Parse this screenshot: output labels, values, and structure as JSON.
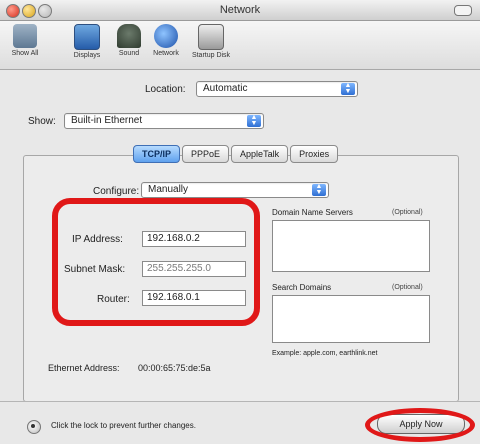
{
  "window": {
    "title": "Network"
  },
  "toolbar": {
    "items": [
      {
        "label": "Show All",
        "icon": "show-all-icon"
      },
      {
        "label": "Displays",
        "icon": "displays-icon"
      },
      {
        "label": "Sound",
        "icon": "sound-icon"
      },
      {
        "label": "Network",
        "icon": "network-icon"
      },
      {
        "label": "Startup Disk",
        "icon": "startup-disk-icon"
      }
    ]
  },
  "location": {
    "label": "Location:",
    "value": "Automatic"
  },
  "show": {
    "label": "Show:",
    "value": "Built-in Ethernet"
  },
  "tabs": [
    {
      "label": "TCP/IP",
      "active": true
    },
    {
      "label": "PPPoE",
      "active": false
    },
    {
      "label": "AppleTalk",
      "active": false
    },
    {
      "label": "Proxies",
      "active": false
    }
  ],
  "configure": {
    "label": "Configure:",
    "value": "Manually"
  },
  "tcpip": {
    "ip_label": "IP Address:",
    "ip_value": "192.168.0.2",
    "subnet_label": "Subnet Mask:",
    "subnet_value": "255.255.255.0",
    "router_label": "Router:",
    "router_value": "192.168.0.1"
  },
  "dns": {
    "label": "Domain Name Servers",
    "optional": "(Optional)"
  },
  "search": {
    "label": "Search Domains",
    "optional": "(Optional)"
  },
  "example": "Example: apple.com, earthlink.net",
  "ethernet": {
    "label": "Ethernet Address:",
    "value": "00:00:65:75:de:5a"
  },
  "footer": {
    "lock_text": "Click the lock to prevent further changes.",
    "apply_label": "Apply Now"
  },
  "colors": {
    "highlight_red": "#e01818",
    "active_tab_blue": "#5fa1ee"
  }
}
